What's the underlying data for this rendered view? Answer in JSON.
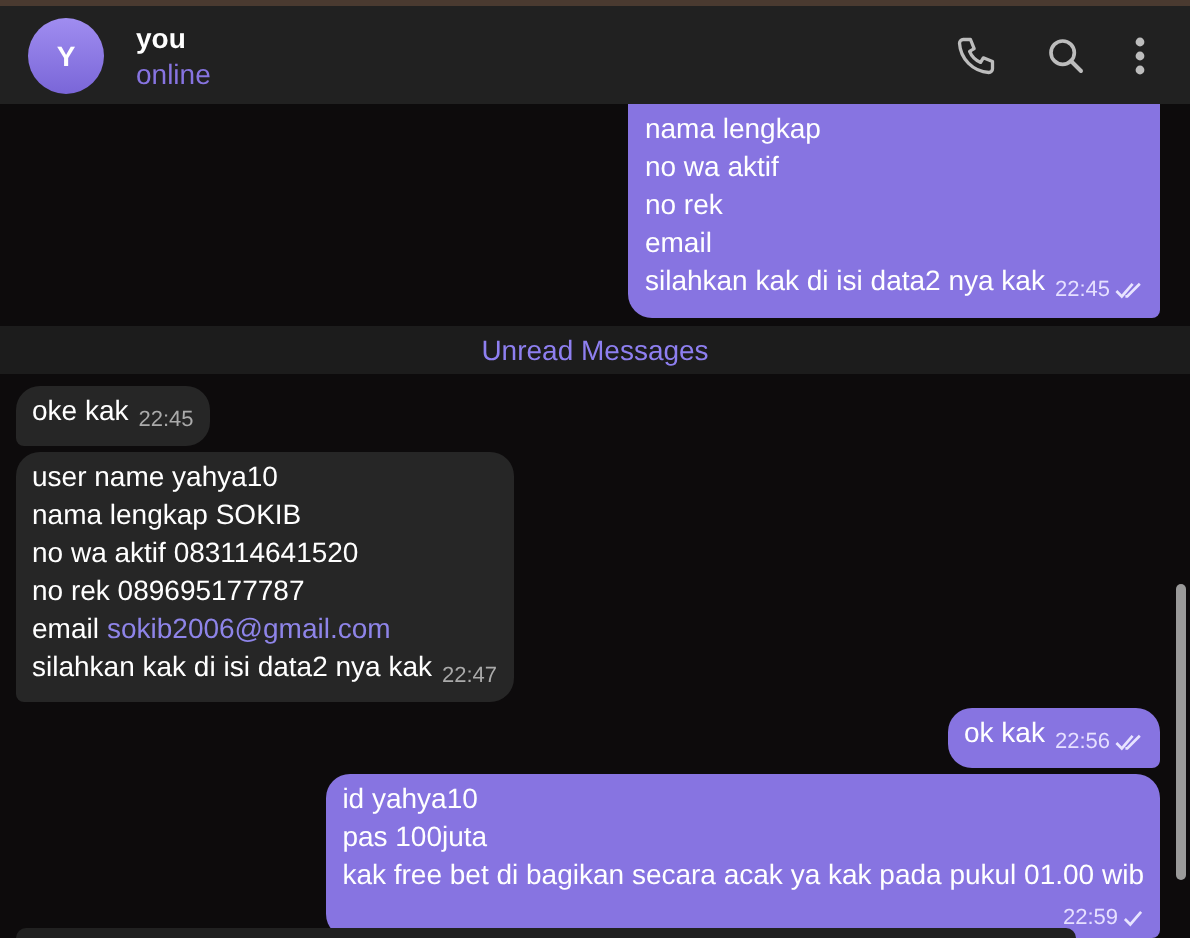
{
  "header": {
    "avatar_letter": "Y",
    "name": "you",
    "status": "online"
  },
  "messages": [
    {
      "kind": "outgoing",
      "lines": [
        "nama lengkap",
        "no wa aktif",
        "no rek",
        "email",
        "silahkan kak di isi data2 nya kak"
      ],
      "time": "22:45",
      "read": true,
      "cut_top": true
    },
    {
      "kind": "divider",
      "text": "Unread Messages"
    },
    {
      "kind": "incoming",
      "lines": [
        "oke kak"
      ],
      "time": "22:45"
    },
    {
      "kind": "incoming",
      "lines": [
        "user name yahya10",
        "nama lengkap SOKIB",
        "no wa aktif 083114641520",
        "no rek 089695177787",
        {
          "text": "email",
          "link": "sokib2006@gmail.com"
        },
        "silahkan kak di isi data2 nya kak"
      ],
      "time": "22:47"
    },
    {
      "kind": "outgoing",
      "lines": [
        "ok kak"
      ],
      "time": "22:56",
      "read": true
    },
    {
      "kind": "outgoing",
      "lines": [
        "id yahya10",
        "pas 100juta",
        "kak free bet di bagikan secara acak ya kak pada pukul 01.00 wib"
      ],
      "time": "22:59",
      "read": false,
      "time_below": true
    }
  ]
}
